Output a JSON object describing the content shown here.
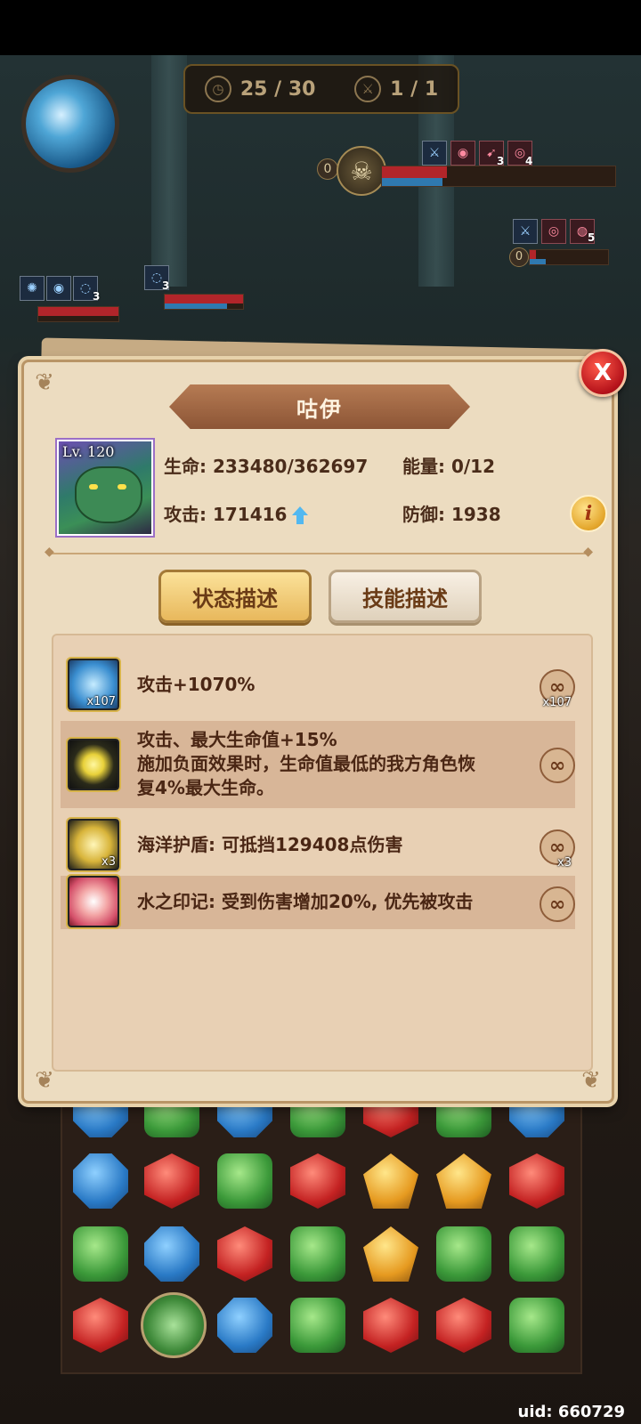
{
  "hud": {
    "turns": "25 / 30",
    "waves": "1 / 1",
    "boss_shield": "0",
    "enemy_shield": "0",
    "boss_buff_counts": [
      "3",
      "4"
    ],
    "enemy_buff_count": "5",
    "ally1_buff_count": "3",
    "ally2_buff_count": "3",
    "uid": "uid: 660729"
  },
  "panel": {
    "hero_name": "咕伊",
    "level": "Lv. 120",
    "hp": "生命: 233480/362697",
    "energy": "能量: 0/12",
    "attack": "攻击: 171416",
    "defense": "防御: 1938",
    "tabs": [
      {
        "label": "状态描述",
        "active": true
      },
      {
        "label": "技能描述",
        "active": false
      }
    ],
    "statuses": [
      {
        "icon": "conch-buff-icon",
        "text": "攻击+1070%",
        "stack": "x107",
        "duration_stack": "x107"
      },
      {
        "icon": "sun-sigil-icon",
        "lines": [
          "攻击、最大生命值+15%",
          "施加负面效果时，生命值最低的我方角色恢",
          "复4%最大生命。"
        ],
        "stack": "",
        "duration_stack": ""
      },
      {
        "icon": "ocean-shield-icon",
        "text": "海洋护盾: 可抵挡129408点伤害",
        "stack": "x3",
        "duration_stack": "x3"
      },
      {
        "icon": "water-mark-icon",
        "text": "水之印记: 受到伤害增加20%, 优先被攻击",
        "stack": "",
        "duration_stack": ""
      }
    ],
    "infinity_symbol": "∞",
    "close_symbol": "X",
    "info_symbol": "i"
  },
  "colors": {
    "panel_bg": "#ecdcc0",
    "banner": "#a8694a",
    "active_tab": "#f2cc78",
    "close": "#c8161e"
  }
}
